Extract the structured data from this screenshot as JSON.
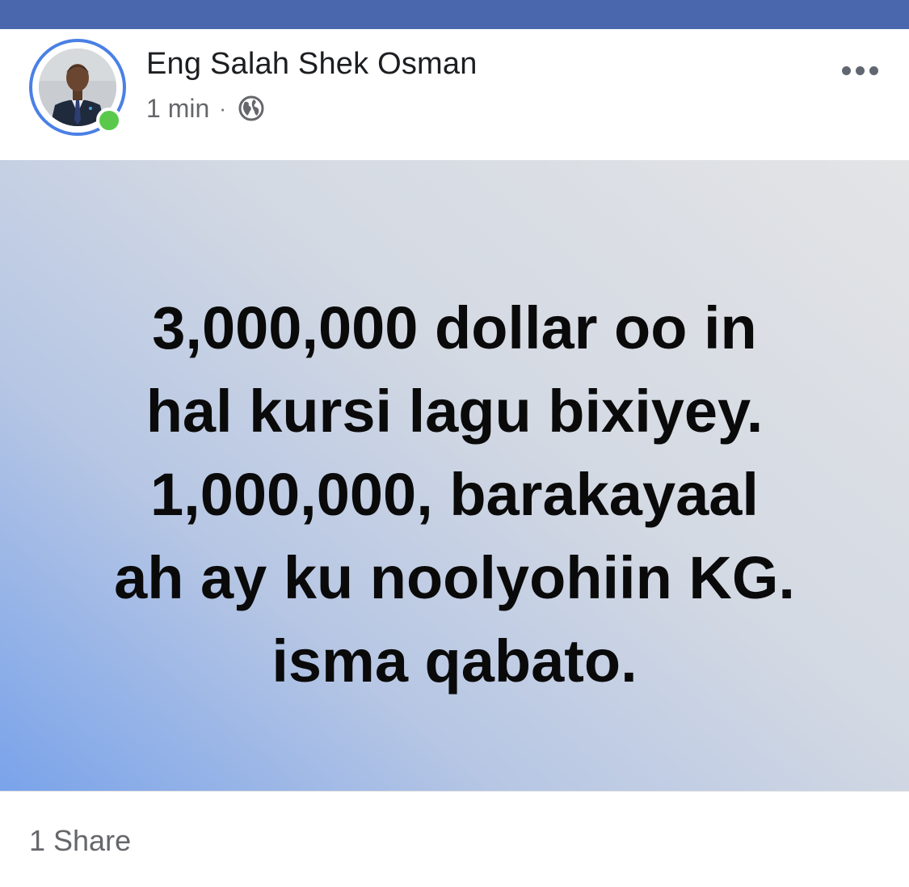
{
  "post": {
    "author": "Eng Salah Shek Osman",
    "timestamp": "1 min",
    "separator": "·",
    "privacy_icon": "globe-icon",
    "more_icon": "more-horizontal-icon",
    "status": "online",
    "text": "3,000,000 dollar oo in\nhal kursi lagu bixiyey.\n1,000,000, barakayaal\nah  ay ku noolyohiin KG.\nisma qabato.",
    "share_count": "1 Share"
  },
  "colors": {
    "top_bar": "#4a67ad",
    "avatar_ring": "#4a80e6",
    "online": "#5ac94b",
    "gradient_start": "#7aa3ea",
    "gradient_end": "#e3e4e6",
    "secondary_text": "#65676b"
  }
}
